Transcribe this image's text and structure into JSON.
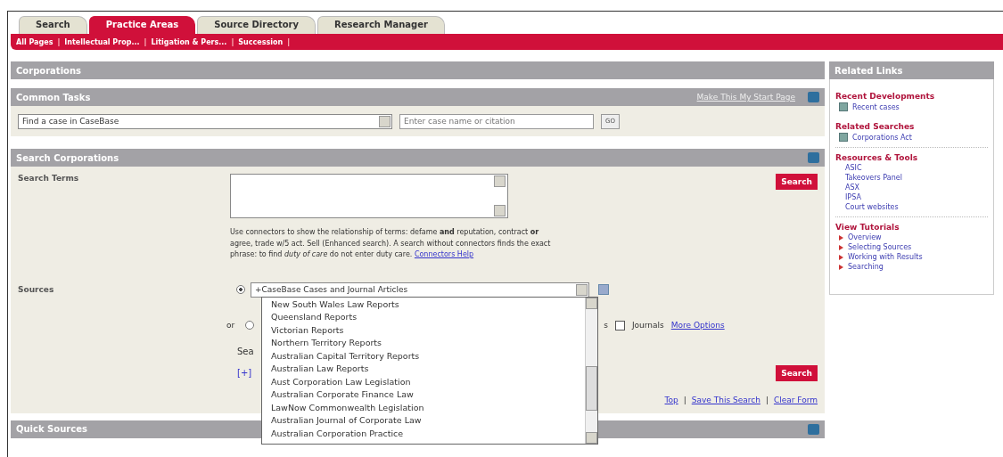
{
  "tabs": [
    {
      "label": "Search",
      "selected": false
    },
    {
      "label": "Practice Areas",
      "selected": true
    },
    {
      "label": "Source Directory",
      "selected": false
    },
    {
      "label": "Research Manager",
      "selected": false
    }
  ],
  "subnav": {
    "separator": "|",
    "items": [
      "All Pages",
      "Intellectual Prop...",
      "Litigation & Pers...",
      "Succession"
    ]
  },
  "page_title": "Corporations",
  "common_tasks": {
    "title": "Common Tasks",
    "start_link": "Make This My Start Page",
    "task": "Find a case in CaseBase",
    "placeholder": "Enter case name or citation",
    "go": "GO"
  },
  "search_panel": {
    "title": "Search Corporations",
    "terms_label": "Search Terms",
    "search_button": "Search",
    "help": "Use connectors to show the relationship of terms: defame **and** reputation, contract **or** agree, trade w/5 act. Sell (Enhanced search). A search without connectors finds the exact phrase: to find *duty of care* do not enter duty care.",
    "help_link": "Connectors Help",
    "sources_label": "Sources",
    "source_selected": true,
    "source": "+CaseBase Cases and Journal Articles",
    "alt": {
      "label": "or",
      "selected": false,
      "fragment": "s",
      "journals_checked": false,
      "journals": "Journals",
      "more": "More Options"
    },
    "search_fragment": "Sea",
    "expand": "[+]",
    "search_button_2": "Search",
    "links": [
      "Top",
      "Save This Search",
      "Clear Form"
    ],
    "link_separator": "|",
    "list": [
      "New South Wales Law Reports",
      "Queensland Reports",
      "Victorian Reports",
      "Northern Territory Reports",
      "Australian Capital Territory Reports",
      "Australian Law Reports",
      "Aust Corporation Law Legislation",
      "Australian Corporate Finance Law",
      "LawNow Commonwealth Legislation",
      "Australian Journal of Corporate Law",
      "Australian Corporation Practice"
    ]
  },
  "quick_sources": {
    "title": "Quick Sources"
  },
  "related": {
    "title": "Related Links",
    "sections": [
      {
        "title": "Recent Developments",
        "kind": "boxed",
        "items": [
          "Recent cases"
        ]
      },
      {
        "title": "Related Searches",
        "kind": "boxed",
        "items": [
          "Corporations Act"
        ]
      },
      {
        "title": "Resources & Tools",
        "kind": "plain",
        "items": [
          "ASIC",
          "Takeovers Panel",
          "ASX",
          "IPSA",
          "Court websites"
        ]
      },
      {
        "title": "View Tutorials",
        "kind": "arrow",
        "items": [
          "Overview",
          "Selecting Sources",
          "Working with Results",
          "Searching"
        ]
      }
    ]
  }
}
